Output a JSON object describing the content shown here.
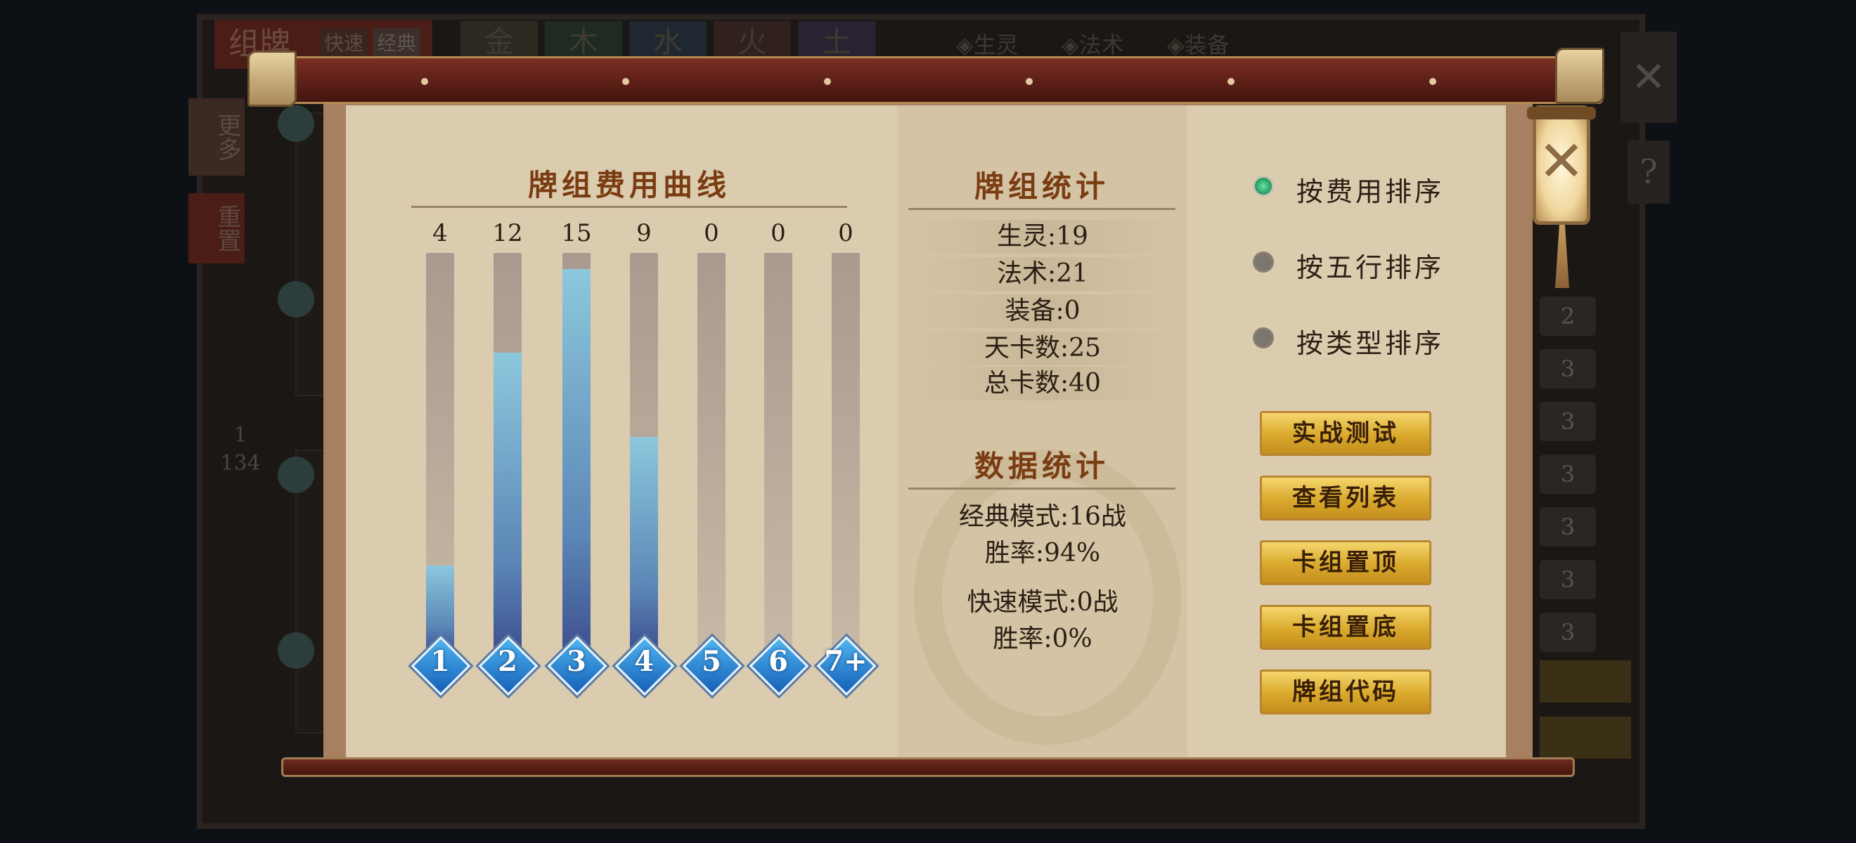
{
  "background": {
    "title": "组牌",
    "mini_tabs": [
      "快速",
      "经典"
    ],
    "element_tabs": [
      "金",
      "木",
      "水",
      "火",
      "土"
    ],
    "filter_tabs": [
      "◈生灵",
      "◈法术",
      "◈装备"
    ],
    "side_buttons": [
      "更多",
      "重置"
    ],
    "page_indicator": {
      "current": "1",
      "total": "134"
    },
    "close_symbol": "✕",
    "help_symbol": "?",
    "list_costs": [
      "2",
      "3",
      "3",
      "3",
      "3",
      "3",
      "3"
    ]
  },
  "cost_curve": {
    "title": "牌组费用曲线",
    "bars": [
      {
        "cost": "1",
        "count": "4",
        "fill": 0.22
      },
      {
        "cost": "2",
        "count": "12",
        "fill": 0.75
      },
      {
        "cost": "3",
        "count": "15",
        "fill": 0.96
      },
      {
        "cost": "4",
        "count": "9",
        "fill": 0.54
      },
      {
        "cost": "5",
        "count": "0",
        "fill": 0
      },
      {
        "cost": "6",
        "count": "0",
        "fill": 0
      },
      {
        "cost": "7+",
        "count": "0",
        "fill": 0
      }
    ]
  },
  "deck_stats": {
    "title": "牌组统计",
    "rows": [
      "生灵:19",
      "法术:21",
      "装备:0",
      "天卡数:25",
      "总卡数:40"
    ]
  },
  "data_stats": {
    "title": "数据统计",
    "classic_mode": "经典模式:16战",
    "classic_winrate": "胜率:94%",
    "quick_mode": "快速模式:0战",
    "quick_winrate": "胜率:0%"
  },
  "sort_options": [
    {
      "label": "按费用排序",
      "selected": true
    },
    {
      "label": "按五行排序",
      "selected": false
    },
    {
      "label": "按类型排序",
      "selected": false
    }
  ],
  "action_buttons": [
    "实战测试",
    "查看列表",
    "卡组置顶",
    "卡组置底",
    "牌组代码"
  ],
  "close_button": {
    "symbol": "✕"
  },
  "colors": {
    "bar_fill_top": "#8cc8dc",
    "bar_fill_bottom": "#3d4f8e",
    "gold_button": "#d9a92c",
    "title_brown": "#7a3c12",
    "radio_selected": "#29a36a"
  }
}
